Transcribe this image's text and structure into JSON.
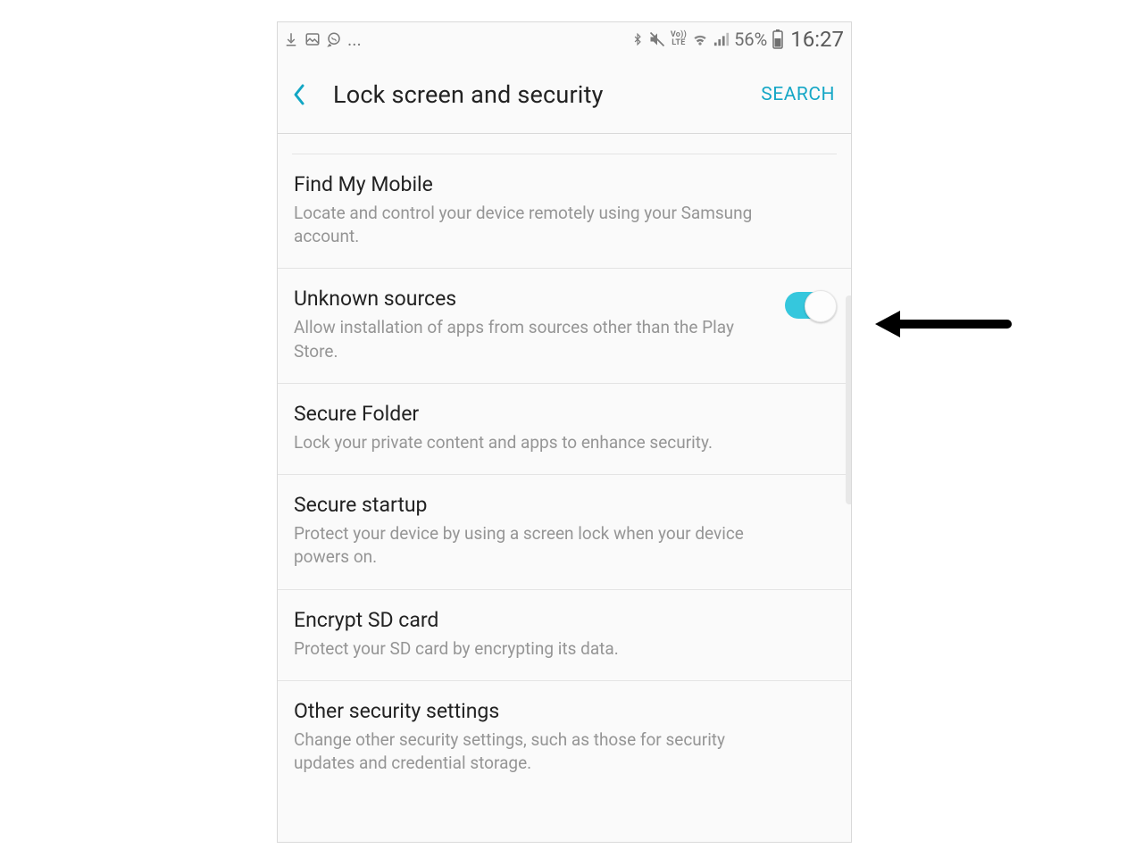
{
  "status": {
    "battery_pct": "56%",
    "time": "16:27",
    "ellipsis": "..."
  },
  "header": {
    "title": "Lock screen and security",
    "search": "SEARCH"
  },
  "items": [
    {
      "title": "Find My Mobile",
      "sub": "Locate and control your device remotely using your Samsung account.",
      "toggle": false
    },
    {
      "title": "Unknown sources",
      "sub": "Allow installation of apps from sources other than the Play Store.",
      "toggle": true,
      "toggle_on": true
    },
    {
      "title": "Secure Folder",
      "sub": "Lock your private content and apps to enhance security.",
      "toggle": false
    },
    {
      "title": "Secure startup",
      "sub": "Protect your device by using a screen lock when your device powers on.",
      "toggle": false
    },
    {
      "title": "Encrypt SD card",
      "sub": "Protect your SD card by encrypting its data.",
      "toggle": false
    },
    {
      "title": "Other security settings",
      "sub": "Change other security settings, such as those for security updates and credential storage.",
      "toggle": false
    }
  ]
}
